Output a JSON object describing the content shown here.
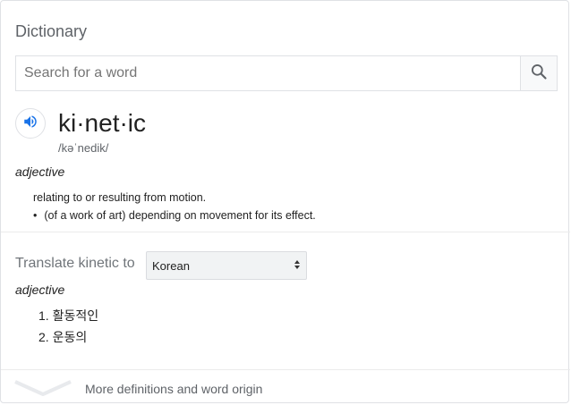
{
  "card": {
    "title": "Dictionary"
  },
  "search": {
    "placeholder": "Search for a word",
    "button_icon": "search-icon"
  },
  "entry": {
    "speaker_icon": "speaker-icon",
    "word": "ki·net·ic",
    "phonetic": "/kəˈnedik/",
    "part_of_speech": "adjective",
    "definition": "relating to or resulting from motion.",
    "sub_definition": "(of a work of art) depending on movement for its effect.",
    "bullet": "•"
  },
  "translate": {
    "label": "Translate kinetic to",
    "selected_language": "Korean",
    "part_of_speech": "adjective",
    "items": [
      {
        "num": "1.",
        "text": "활동적인"
      },
      {
        "num": "2.",
        "text": "운동의"
      }
    ]
  },
  "footer": {
    "more_label": "More definitions and word origin",
    "chevron_icon": "chevron-down-icon"
  },
  "colors": {
    "speaker_blue": "#1a73e8",
    "muted_gray": "#5f6368",
    "border": "#dfe1e5"
  }
}
